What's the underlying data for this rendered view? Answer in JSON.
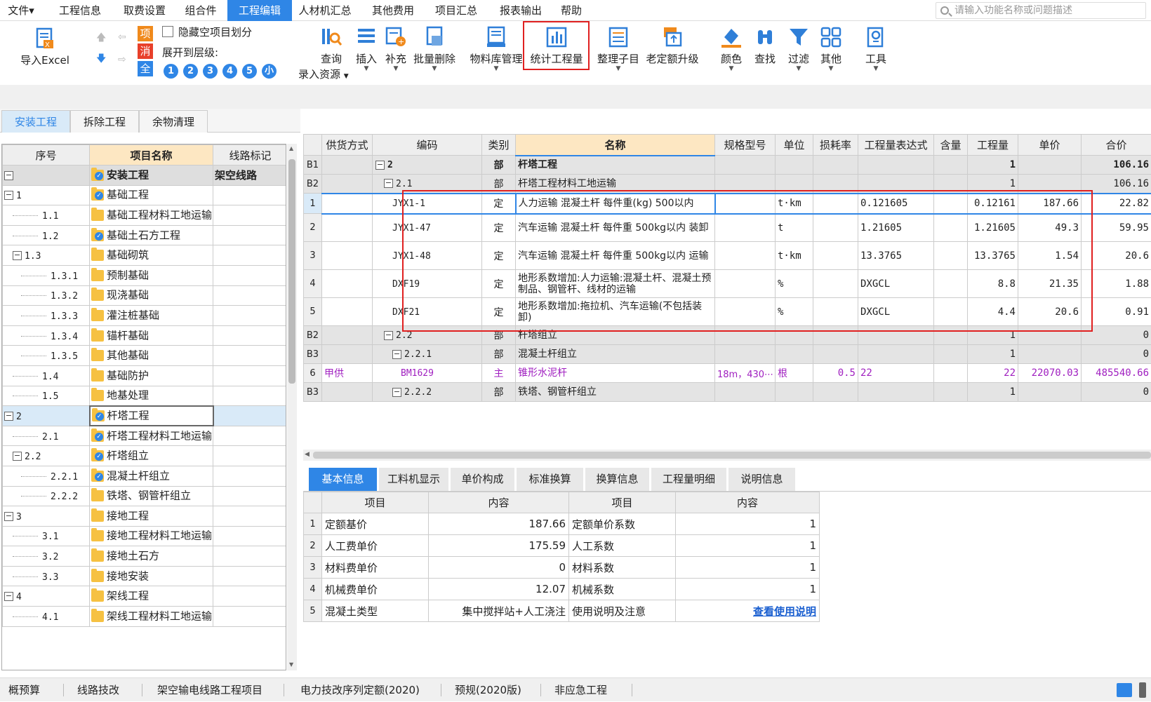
{
  "menu": {
    "items": [
      "文件▾",
      "工程信息",
      "取费设置",
      "组合件",
      "工程编辑",
      "人材机汇总",
      "其他费用",
      "项目汇总",
      "报表输出",
      "帮助"
    ],
    "active_index": 4,
    "search_placeholder": "请输入功能名称或问题描述"
  },
  "toolbar": {
    "import_excel": "导入Excel",
    "badge_item": "项",
    "badge_clear": "消",
    "badge_all": "全",
    "hide_empty": "隐藏空项目划分",
    "expand_level": "展开到层级:",
    "levels": [
      "1",
      "2",
      "3",
      "4",
      "5",
      "小"
    ],
    "query": "查询",
    "input_resource": "录入资源",
    "insert": "插入",
    "supplement": "补充",
    "batch_delete": "批量删除",
    "material_lib": "物料库管理",
    "stat_quantity": "统计工程量",
    "organize": "整理子目",
    "upgrade": "老定额升级",
    "color": "颜色",
    "find": "查找",
    "filter": "过滤",
    "other": "其他",
    "tools": "工具"
  },
  "left_tabs": [
    "安装工程",
    "拆除工程",
    "余物清理"
  ],
  "left_tree": {
    "headers": [
      "序号",
      "项目名称",
      "线路标记"
    ],
    "rows": [
      {
        "no": "",
        "name": "安装工程",
        "mark": "架空线路",
        "level": 0,
        "exp": "−",
        "chk": true,
        "grey": true
      },
      {
        "no": "1",
        "name": "基础工程",
        "mark": "",
        "level": 1,
        "exp": "−",
        "chk": true
      },
      {
        "no": "1.1",
        "name": "基础工程材料工地运输",
        "mark": "",
        "level": 2,
        "exp": "",
        "chk": false
      },
      {
        "no": "1.2",
        "name": "基础土石方工程",
        "mark": "",
        "level": 2,
        "exp": "",
        "chk": true
      },
      {
        "no": "1.3",
        "name": "基础砌筑",
        "mark": "",
        "level": 2,
        "exp": "−",
        "chk": false
      },
      {
        "no": "1.3.1",
        "name": "预制基础",
        "mark": "",
        "level": 3,
        "exp": "",
        "chk": false
      },
      {
        "no": "1.3.2",
        "name": "现浇基础",
        "mark": "",
        "level": 3,
        "exp": "",
        "chk": false
      },
      {
        "no": "1.3.3",
        "name": "灌注桩基础",
        "mark": "",
        "level": 3,
        "exp": "",
        "chk": false
      },
      {
        "no": "1.3.4",
        "name": "锚杆基础",
        "mark": "",
        "level": 3,
        "exp": "",
        "chk": false
      },
      {
        "no": "1.3.5",
        "name": "其他基础",
        "mark": "",
        "level": 3,
        "exp": "",
        "chk": false
      },
      {
        "no": "1.4",
        "name": "基础防护",
        "mark": "",
        "level": 2,
        "exp": "",
        "chk": false
      },
      {
        "no": "1.5",
        "name": "地基处理",
        "mark": "",
        "level": 2,
        "exp": "",
        "chk": false
      },
      {
        "no": "2",
        "name": "杆塔工程",
        "mark": "",
        "level": 1,
        "exp": "−",
        "chk": true,
        "sel": true
      },
      {
        "no": "2.1",
        "name": "杆塔工程材料工地运输",
        "mark": "",
        "level": 2,
        "exp": "",
        "chk": true
      },
      {
        "no": "2.2",
        "name": "杆塔组立",
        "mark": "",
        "level": 2,
        "exp": "−",
        "chk": true
      },
      {
        "no": "2.2.1",
        "name": "混凝土杆组立",
        "mark": "",
        "level": 3,
        "exp": "",
        "chk": true
      },
      {
        "no": "2.2.2",
        "name": "铁塔、钢管杆组立",
        "mark": "",
        "level": 3,
        "exp": "",
        "chk": false
      },
      {
        "no": "3",
        "name": "接地工程",
        "mark": "",
        "level": 1,
        "exp": "−",
        "chk": false
      },
      {
        "no": "3.1",
        "name": "接地工程材料工地运输",
        "mark": "",
        "level": 2,
        "exp": "",
        "chk": false
      },
      {
        "no": "3.2",
        "name": "接地土石方",
        "mark": "",
        "level": 2,
        "exp": "",
        "chk": false
      },
      {
        "no": "3.3",
        "name": "接地安装",
        "mark": "",
        "level": 2,
        "exp": "",
        "chk": false
      },
      {
        "no": "4",
        "name": "架线工程",
        "mark": "",
        "level": 1,
        "exp": "−",
        "chk": false
      },
      {
        "no": "4.1",
        "name": "架线工程材料工地运输",
        "mark": "",
        "level": 2,
        "exp": "",
        "chk": false
      }
    ]
  },
  "grid": {
    "headers": [
      "",
      "供货方式",
      "编码",
      "类别",
      "名称",
      "规格型号",
      "单位",
      "损耗率",
      "工程量表达式",
      "含量",
      "工程量",
      "单价",
      "合价"
    ],
    "rows": [
      {
        "rn": "B1",
        "supply": "",
        "code": "2",
        "cat": "部",
        "name": "杆塔工程",
        "spec": "",
        "unit": "",
        "loss": "",
        "expr": "",
        "content": "",
        "qty": "1",
        "price": "",
        "total": "106.16",
        "type": "b",
        "indent": 0,
        "exp": true
      },
      {
        "rn": "B2",
        "supply": "",
        "code": "2.1",
        "cat": "部",
        "name": "杆塔工程材料工地运输",
        "spec": "",
        "unit": "",
        "loss": "",
        "expr": "",
        "content": "",
        "qty": "1",
        "price": "",
        "total": "106.16",
        "type": "b",
        "indent": 1,
        "exp": true
      },
      {
        "rn": "1",
        "supply": "",
        "code": "JYX1-1",
        "cat": "定",
        "name": "人力运输 混凝土杆 每件重(kg) 500以内",
        "spec": "",
        "unit": "t·km",
        "loss": "",
        "expr": "0.121605",
        "content": "",
        "qty": "0.12161",
        "price": "187.66",
        "total": "22.82",
        "type": "d",
        "indent": 2,
        "sel": true
      },
      {
        "rn": "2",
        "supply": "",
        "code": "JYX1-47",
        "cat": "定",
        "name": "汽车运输 混凝土杆 每件重 500kg以内 装卸",
        "spec": "",
        "unit": "t",
        "loss": "",
        "expr": "1.21605",
        "content": "",
        "qty": "1.21605",
        "price": "49.3",
        "total": "59.95",
        "type": "d",
        "indent": 2
      },
      {
        "rn": "3",
        "supply": "",
        "code": "JYX1-48",
        "cat": "定",
        "name": "汽车运输 混凝土杆 每件重 500kg以内 运输",
        "spec": "",
        "unit": "t·km",
        "loss": "",
        "expr": "13.3765",
        "content": "",
        "qty": "13.3765",
        "price": "1.54",
        "total": "20.6",
        "type": "d",
        "indent": 2
      },
      {
        "rn": "4",
        "supply": "",
        "code": "DXF19",
        "cat": "定",
        "name": "地形系数增加:人力运输:混凝土杆、混凝土预制品、钢管杆、线材的运输",
        "spec": "",
        "unit": "%",
        "loss": "",
        "expr": "DXGCL",
        "content": "",
        "qty": "8.8",
        "price": "21.35",
        "total": "1.88",
        "type": "d",
        "indent": 2
      },
      {
        "rn": "5",
        "supply": "",
        "code": "DXF21",
        "cat": "定",
        "name": "地形系数增加:拖拉机、汽车运输(不包括装卸)",
        "spec": "",
        "unit": "%",
        "loss": "",
        "expr": "DXGCL",
        "content": "",
        "qty": "4.4",
        "price": "20.6",
        "total": "0.91",
        "type": "d",
        "indent": 2
      },
      {
        "rn": "B2",
        "supply": "",
        "code": "2.2",
        "cat": "部",
        "name": "杆塔组立",
        "spec": "",
        "unit": "",
        "loss": "",
        "expr": "",
        "content": "",
        "qty": "1",
        "price": "",
        "total": "0",
        "type": "b",
        "indent": 1,
        "exp": true
      },
      {
        "rn": "B3",
        "supply": "",
        "code": "2.2.1",
        "cat": "部",
        "name": "混凝土杆组立",
        "spec": "",
        "unit": "",
        "loss": "",
        "expr": "",
        "content": "",
        "qty": "1",
        "price": "",
        "total": "0",
        "type": "b",
        "indent": 2,
        "exp": true
      },
      {
        "rn": "6",
        "supply": "甲供",
        "code": "BM1629",
        "cat": "主",
        "name": "锥形水泥杆",
        "spec": "18m，430⋯",
        "unit": "根",
        "loss": "0.5",
        "expr": "22",
        "content": "",
        "qty": "22",
        "price": "22070.03",
        "total": "485540.66",
        "type": "m",
        "indent": 3
      },
      {
        "rn": "B3",
        "supply": "",
        "code": "2.2.2",
        "cat": "部",
        "name": "铁塔、钢管杆组立",
        "spec": "",
        "unit": "",
        "loss": "",
        "expr": "",
        "content": "",
        "qty": "1",
        "price": "",
        "total": "0",
        "type": "b",
        "indent": 2,
        "exp": false
      }
    ]
  },
  "bottom_tabs": [
    "基本信息",
    "工料机显示",
    "单价构成",
    "标准换算",
    "换算信息",
    "工程量明细",
    "说明信息"
  ],
  "info": {
    "headers": [
      "",
      "项目",
      "内容",
      "项目",
      "内容"
    ],
    "rows": [
      {
        "n": "1",
        "k1": "定额基价",
        "v1": "187.66",
        "k2": "定额单价系数",
        "v2": "1"
      },
      {
        "n": "2",
        "k1": "人工费单价",
        "v1": "175.59",
        "k2": "人工系数",
        "v2": "1"
      },
      {
        "n": "3",
        "k1": "材料费单价",
        "v1": "0",
        "k2": "材料系数",
        "v2": "1"
      },
      {
        "n": "4",
        "k1": "机械费单价",
        "v1": "12.07",
        "k2": "机械系数",
        "v2": "1"
      },
      {
        "n": "5",
        "k1": "混凝土类型",
        "v1": "集中搅拌站+人工浇注",
        "k2": "使用说明及注意",
        "v2": "查看使用说明"
      }
    ]
  },
  "status": [
    "概预算",
    "线路技改",
    "架空输电线路工程项目",
    "电力技改序列定额(2020)",
    "预规(2020版)",
    "非应急工程"
  ]
}
